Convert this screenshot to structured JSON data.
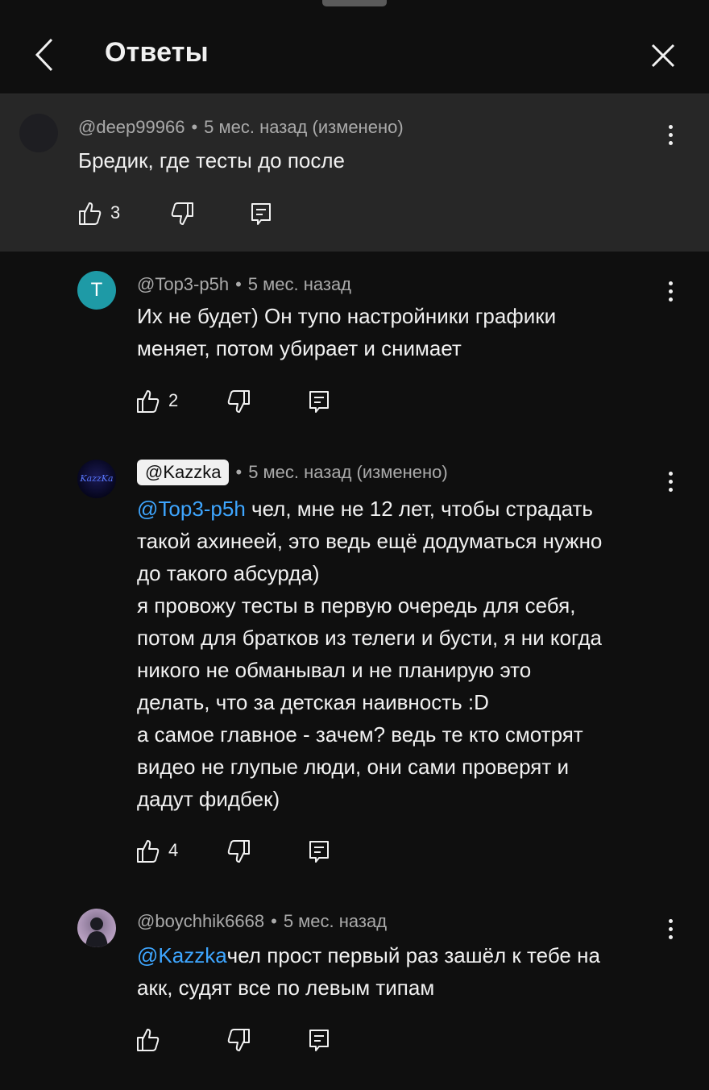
{
  "header": {
    "title": "Ответы"
  },
  "colors": {
    "background": "#0f0f0f",
    "highlight": "#272727",
    "mention": "#3ea6ff",
    "secondary_text": "#aaaaaa"
  },
  "comments": [
    {
      "author": "@deep99966",
      "separator": "•",
      "time": "5 мес. назад (изменено)",
      "lines": [
        "Бредик, где тесты до после"
      ],
      "likes": "3"
    },
    {
      "author": "@Top3-p5h",
      "avatar_letter": "T",
      "separator": "•",
      "time": "5 мес. назад",
      "lines": [
        "Их не будет) Он тупо настройники графики",
        "меняет, потом убирает и снимает"
      ],
      "likes": "2"
    },
    {
      "author": "@Kazzka",
      "avatar_text": "KazzKa",
      "separator": "•",
      "time": "5 мес. назад (изменено)",
      "mention": "@Top3-p5h",
      "first_line_rest": " чел, мне не 12 лет, чтобы страдать",
      "lines": [
        "такой ахинеей, это ведь ещё додуматься нужно",
        "до такого абсурда)",
        "я провожу тесты в первую очередь для себя,",
        "потом для братков из телеги и бусти, я ни когда",
        "никого не обманывал и не планирую это",
        "делать, что за детская наивность :D",
        "а самое главное - зачем? ведь те кто смотрят",
        "видео не глупые люди, они сами проверят и",
        "дадут фидбек)"
      ],
      "likes": "4"
    },
    {
      "author": "@boychhik6668",
      "separator": "•",
      "time": "5 мес. назад",
      "mention": "@Kazzka",
      "first_line_rest": "чел прост первый раз зашёл к тебе на",
      "lines": [
        "акк, судят все по левым типам"
      ]
    }
  ]
}
